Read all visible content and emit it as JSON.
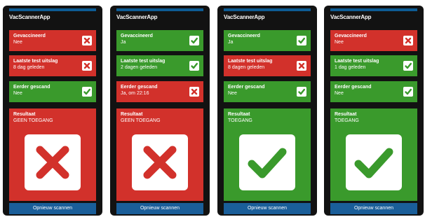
{
  "app_title": "VacScannerApp",
  "labels": {
    "vaccinated": "Gevaccineerd",
    "last_test": "Laatste test uitslag",
    "scanned": "Eerder gescand",
    "result": "Resultaat",
    "rescan_button": "Opnieuw scannen"
  },
  "phones": [
    {
      "vaccinated": "Nee",
      "last_test": "8 dag geleden",
      "scanned": "Nee",
      "result": "GEEN TOEGANG"
    },
    {
      "vaccinated": "Ja",
      "last_test": "2 dagen geleden",
      "scanned": "Ja, om 22:16",
      "result": "GEEN TOEGANG"
    },
    {
      "vaccinated": "Ja",
      "last_test": "8 dagen geleden",
      "scanned": "Nee",
      "result": "TOEGANG"
    },
    {
      "vaccinated": "Nee",
      "last_test": "1 dag geleden",
      "scanned": "Nee",
      "result": "TOEGANG"
    }
  ],
  "colors": {
    "red": "#d2312b",
    "green": "#3a9a2c",
    "topbar": "#0d5c95",
    "button": "#1a5e99"
  },
  "icons": {
    "positive": "check-icon",
    "negative": "cross-icon"
  }
}
